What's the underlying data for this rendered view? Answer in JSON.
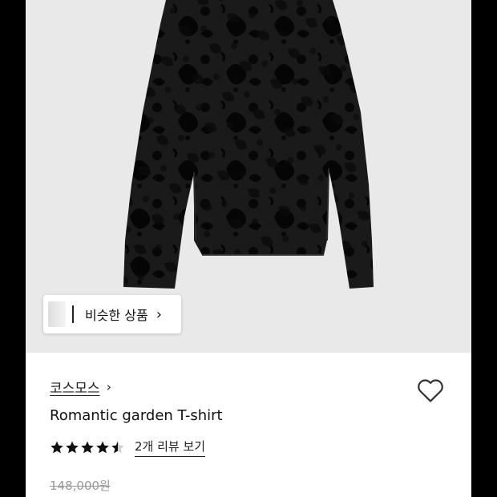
{
  "product_image": {
    "similar_products_label": "비슷한 상품"
  },
  "product": {
    "brand": "코스모스",
    "title": "Romantic garden T-shirt",
    "rating": 4.5,
    "review_link_label": "2개 리뷰 보기",
    "original_price": "148,000원"
  },
  "icons": {
    "brand_chevron": "chevron-right-icon",
    "similar_chevron": "chevron-right-icon",
    "wishlist": "heart-outline-icon",
    "star": "star-icon"
  },
  "colors": {
    "page_background": "#000000",
    "image_background": "#e9e9e9",
    "garment": "#141414",
    "star": "#111111",
    "strikethrough_price": "#999999"
  }
}
